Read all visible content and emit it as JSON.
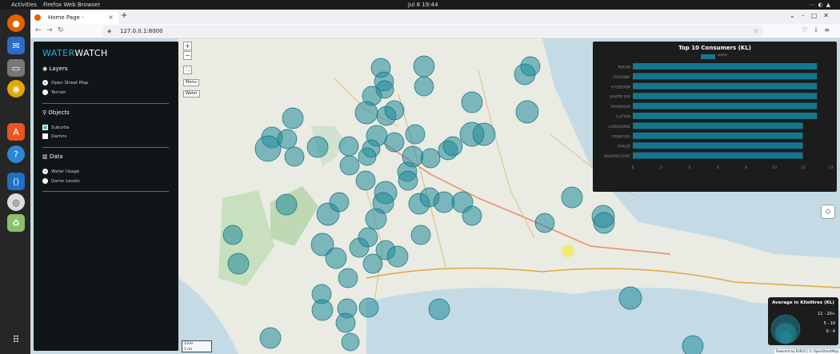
{
  "topbar": {
    "activities": "Activities",
    "app": "Firefox Web Browser",
    "clock": "Jul 8  19:44"
  },
  "dock": {
    "icons": [
      "firefox-icon",
      "thunderbird-icon",
      "files-icon",
      "rhythmbox-icon",
      "software-icon",
      "help-icon",
      "vscode-icon",
      "disc-icon",
      "trash-icon",
      "apps-grid-icon"
    ]
  },
  "browser": {
    "tab_title": "Home Page - WaterWatch",
    "tab_close": "×",
    "new_tab": "+",
    "url": "127.0.0.1:8000"
  },
  "sidebar": {
    "brand_a": "WATER",
    "brand_b": "WATCH",
    "layers": {
      "title": "Layers",
      "options": [
        "Open Street Map",
        "Terrain"
      ],
      "selected": 0
    },
    "objects": {
      "title": "Objects",
      "options": [
        "Suburbs",
        "Damns"
      ],
      "checked": [
        true,
        false
      ]
    },
    "data": {
      "title": "Data",
      "options": [
        "Water Usage",
        "Damn Levels"
      ],
      "selected": 0
    }
  },
  "map_controls": {
    "zoom_in": "+",
    "zoom_out": "−",
    "menu": "Menu",
    "water": "Water"
  },
  "chart_data": {
    "type": "bar",
    "orientation": "horizontal",
    "title": "Top 10 Consumers (KL)",
    "series": [
      {
        "name": "water",
        "color": "#14778e",
        "values": [
          13,
          13,
          13,
          13,
          13,
          13,
          12,
          12,
          12,
          12
        ]
      }
    ],
    "categories": [
      "PAROW",
      "CRAVENBY",
      "VYGEBOOM",
      "BANTRY BAY",
      "PARKWOOD",
      "CLIFTON",
      "LANSDOWNE",
      "CRANFORD",
      "OAKLEE",
      "BISHOPSCOURT"
    ],
    "xticks": [
      0,
      2,
      4,
      6,
      8,
      10,
      12,
      14
    ],
    "xlim": [
      0,
      14
    ],
    "grid": false,
    "legend": "top-center"
  },
  "kl_legend": {
    "title": "Average in Kilolitres (KL)",
    "labels": [
      "11 - 20+",
      "5 - 10",
      "0 - 4"
    ]
  },
  "scale": {
    "km": "3 km",
    "mi": "1 mi"
  },
  "attribution": "Powered by ESRI/3 | © OpenStreetMap",
  "colors": {
    "accent": "#29a9df",
    "bubble": "#1f8a9a",
    "bar": "#14778e"
  }
}
